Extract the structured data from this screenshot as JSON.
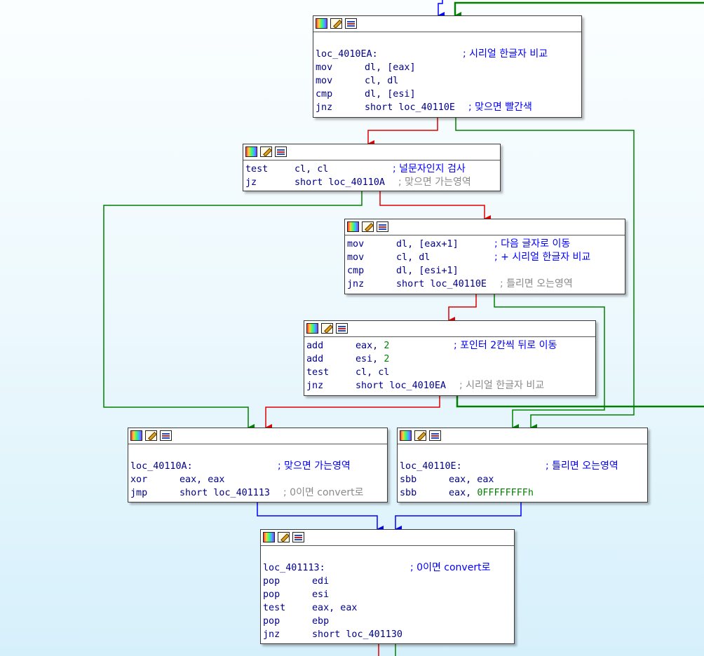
{
  "blocks": [
    {
      "id": "b1",
      "lines": [
        {
          "op": "",
          "args": "",
          "comment": ""
        },
        {
          "op": "loc_4010EA:",
          "args": "",
          "comment": "; 시리얼 한글자 비교",
          "comment_style": "blue"
        },
        {
          "op": "mov",
          "args": "dl, [eax]",
          "comment": ""
        },
        {
          "op": "mov",
          "args": "cl, dl",
          "comment": ""
        },
        {
          "op": "cmp",
          "args": "dl, [esi]",
          "comment": ""
        },
        {
          "op": "jnz",
          "args": "short loc_40110E",
          "comment": "; 맞으면 빨간색",
          "comment_style": "blue"
        }
      ]
    },
    {
      "id": "b2",
      "lines": [
        {
          "op": "test",
          "args": "cl, cl",
          "comment": "; 널문자인지 검사",
          "comment_style": "blue"
        },
        {
          "op": "jz",
          "args": "short loc_40110A",
          "comment": "; 맞으면 가는영역",
          "comment_style": "gray"
        }
      ]
    },
    {
      "id": "b3",
      "lines": [
        {
          "op": "mov",
          "args": "dl, [eax+1]",
          "comment": "; 다음 글자로 이동",
          "comment_style": "blue"
        },
        {
          "op": "mov",
          "args": "cl, dl",
          "comment": "; + 시리얼 한글자 비교",
          "comment_style": "blue"
        },
        {
          "op": "cmp",
          "args": "dl, [esi+1]",
          "comment": ""
        },
        {
          "op": "jnz",
          "args": "short loc_40110E",
          "comment": "; 틀리면 오는영역",
          "comment_style": "gray"
        }
      ]
    },
    {
      "id": "b4",
      "lines": [
        {
          "op": "add",
          "args": "eax, 2",
          "comment": "; 포인터 2칸씩 뒤로 이동",
          "comment_style": "blue"
        },
        {
          "op": "add",
          "args": "esi, 2",
          "comment": ""
        },
        {
          "op": "test",
          "args": "cl, cl",
          "comment": ""
        },
        {
          "op": "jnz",
          "args": "short loc_4010EA",
          "comment": "; 시리얼 한글자 비교",
          "comment_style": "gray"
        }
      ]
    },
    {
      "id": "b5",
      "lines": [
        {
          "op": "",
          "args": "",
          "comment": ""
        },
        {
          "op": "loc_40110A:",
          "args": "",
          "comment": "; 맞으면 가는영역",
          "comment_style": "blue"
        },
        {
          "op": "xor",
          "args": "eax, eax",
          "comment": ""
        },
        {
          "op": "jmp",
          "args": "short loc_401113",
          "comment": "; 0이면 convert로",
          "comment_style": "gray"
        }
      ]
    },
    {
      "id": "b6",
      "lines": [
        {
          "op": "",
          "args": "",
          "comment": ""
        },
        {
          "op": "loc_40110E:",
          "args": "",
          "comment": "; 틀리면 오는영역",
          "comment_style": "blue"
        },
        {
          "op": "sbb",
          "args": "eax, eax",
          "comment": ""
        },
        {
          "op": "sbb",
          "args": "eax, 0FFFFFFFFh",
          "comment": ""
        }
      ]
    },
    {
      "id": "b7",
      "lines": [
        {
          "op": "",
          "args": "",
          "comment": ""
        },
        {
          "op": "loc_401113:",
          "args": "",
          "comment": "; 0이면 convert로",
          "comment_style": "blue"
        },
        {
          "op": "pop",
          "args": "edi",
          "comment": ""
        },
        {
          "op": "pop",
          "args": "esi",
          "comment": ""
        },
        {
          "op": "test",
          "args": "eax, eax",
          "comment": ""
        },
        {
          "op": "pop",
          "args": "ebp",
          "comment": ""
        },
        {
          "op": "jnz",
          "args": "short loc_401130",
          "comment": ""
        }
      ]
    }
  ],
  "edge_colors": {
    "true": "#008000",
    "false": "#e00000",
    "unconditional": "#0000ff"
  },
  "icons": [
    "graph-overview-icon",
    "edit-color-icon",
    "xref-icon"
  ]
}
